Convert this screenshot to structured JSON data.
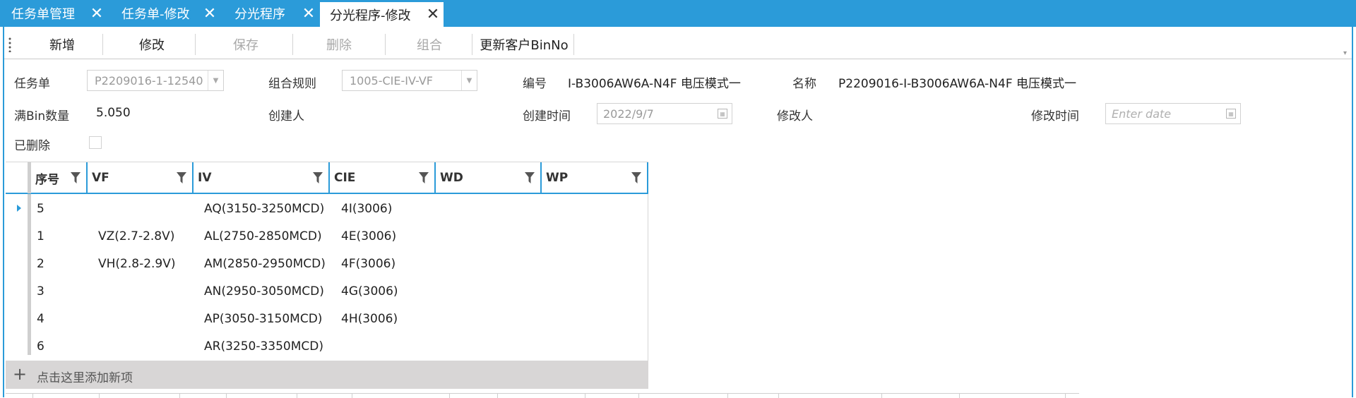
{
  "tabs": [
    {
      "label": "任务单管理",
      "active": false
    },
    {
      "label": "任务单-修改",
      "active": false
    },
    {
      "label": "分光程序",
      "active": false
    },
    {
      "label": "分光程序-修改",
      "active": true
    }
  ],
  "toolbar": {
    "new_label": "新增",
    "edit_label": "修改",
    "save_label": "保存",
    "delete_label": "删除",
    "combine_label": "组合",
    "update_binno_label": "更新客户BinNo"
  },
  "form": {
    "task_order_label": "任务单",
    "task_order_value": "P2209016-1-12540",
    "combine_rule_label": "组合规则",
    "combine_rule_value": "1005-CIE-IV-VF",
    "code_label": "编号",
    "code_value": "I-B3006AW6A-N4F 电压模式一",
    "name_label": "名称",
    "name_value": "P2209016-I-B3006AW6A-N4F 电压模式一",
    "full_bin_label": "满Bin数量",
    "full_bin_value": "5.050",
    "creator_label": "创建人",
    "creator_value": "",
    "created_time_label": "创建时间",
    "created_time_value": "2022/9/7",
    "modifier_label": "修改人",
    "modifier_value": "",
    "modified_time_label": "修改时间",
    "modified_time_placeholder": "Enter date",
    "deleted_label": "已删除",
    "deleted_checked": false
  },
  "grid": {
    "columns": [
      "序号",
      "VF",
      "IV",
      "CIE",
      "WD",
      "WP"
    ],
    "rows": [
      {
        "seq": "5",
        "vf": "",
        "iv": "AQ(3150-3250MCD)",
        "cie": "4I(3006)",
        "wd": "",
        "wp": ""
      },
      {
        "seq": "1",
        "vf": "VZ(2.7-2.8V)",
        "iv": "AL(2750-2850MCD)",
        "cie": "4E(3006)",
        "wd": "",
        "wp": ""
      },
      {
        "seq": "2",
        "vf": "VH(2.8-2.9V)",
        "iv": "AM(2850-2950MCD)",
        "cie": "4F(3006)",
        "wd": "",
        "wp": ""
      },
      {
        "seq": "3",
        "vf": "",
        "iv": "AN(2950-3050MCD)",
        "cie": "4G(3006)",
        "wd": "",
        "wp": ""
      },
      {
        "seq": "4",
        "vf": "",
        "iv": "AP(3050-3150MCD)",
        "cie": "4H(3006)",
        "wd": "",
        "wp": ""
      },
      {
        "seq": "6",
        "vf": "",
        "iv": "AR(3250-3350MCD)",
        "cie": "",
        "wd": "",
        "wp": ""
      }
    ],
    "add_row_label": "点击这里添加新项"
  },
  "colors": {
    "accent": "#2b9bd9",
    "add_row_bg": "#d8d6d6"
  }
}
